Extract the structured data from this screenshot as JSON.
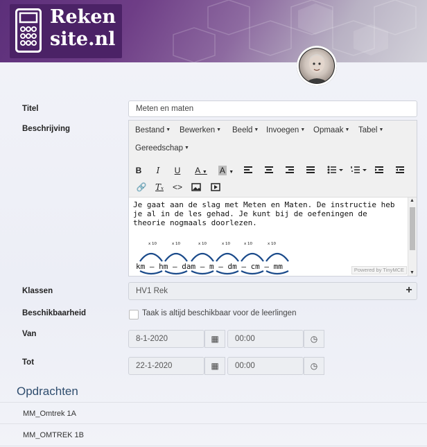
{
  "header": {
    "logo_line1": "Reken",
    "logo_line2": "site.nl"
  },
  "form": {
    "title_label": "Titel",
    "title_value": "Meten en maten",
    "description_label": "Beschrijving",
    "classes_label": "Klassen",
    "classes_value": "HV1 Rek",
    "availability_label": "Beschikbaarheid",
    "availability_checkbox": "Taak is altijd beschikbaar voor de leerlingen",
    "from_label": "Van",
    "from_date": "8-1-2020",
    "from_time": "00:00",
    "to_label": "Tot",
    "to_date": "22-1-2020",
    "to_time": "00:00"
  },
  "editor": {
    "menus": [
      "Bestand",
      "Bewerken",
      "Beeld",
      "Invoegen",
      "Opmaak",
      "Tabel",
      "Gereedschap"
    ],
    "text": "Je gaat aan de slag met Meten en Maten. De instructie heb je al in de les gehad. Je kunt bij de oefeningen de theorie nogmaals doorlezen.",
    "powered_by": "Powered by TinyMCE",
    "diagram_factors": [
      "x 10",
      "x 10",
      "x 10",
      "x 10",
      "x 10",
      "x 10"
    ],
    "diagram_units": "km – hm – dam – m – dm – cm – mm"
  },
  "assignments": {
    "title": "Opdrachten",
    "items": [
      "MM_Omtrek 1A",
      "MM_OMTREK 1B"
    ]
  }
}
